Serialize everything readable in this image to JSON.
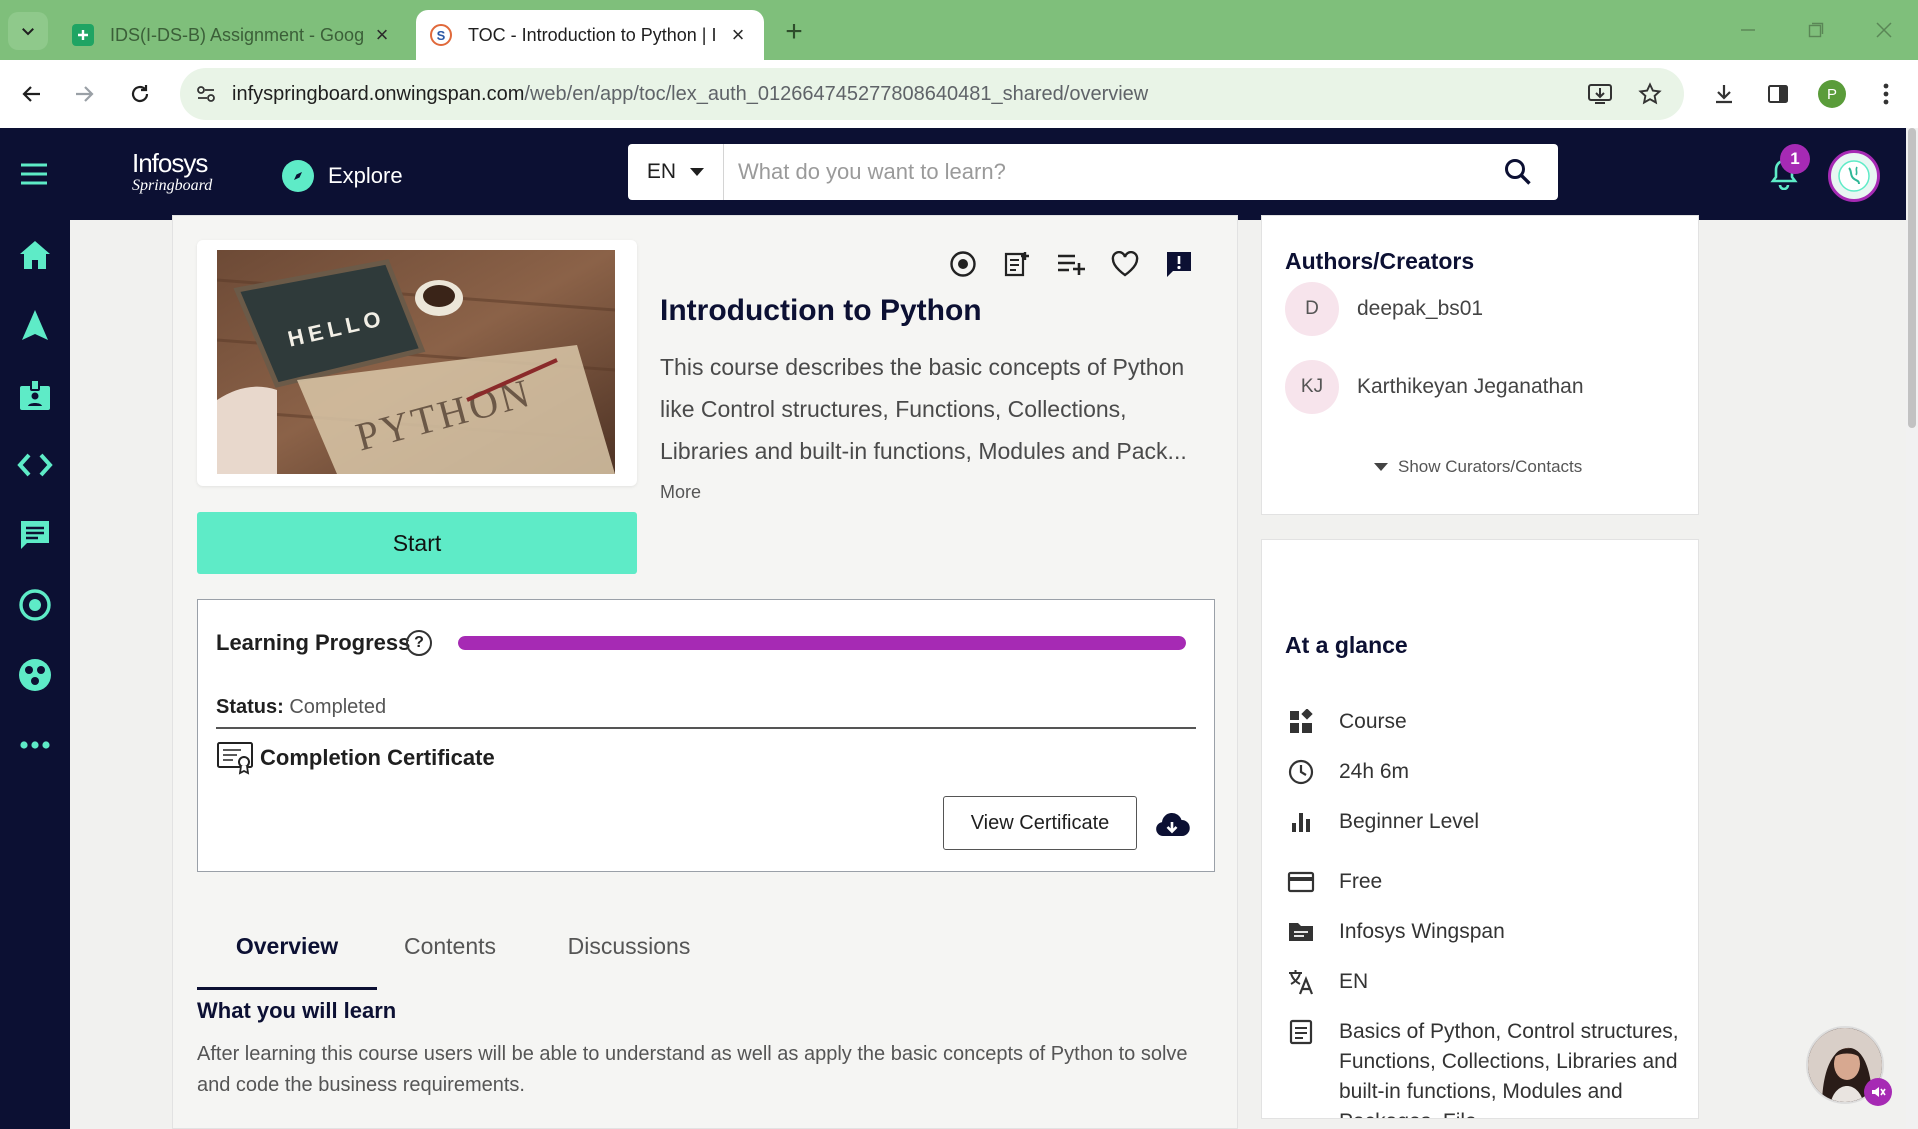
{
  "browser": {
    "tabs": [
      {
        "title": "IDS(I-DS-B) Assignment - Goog",
        "favicon": "google-sheets-icon",
        "active": false
      },
      {
        "title": "TOC - Introduction to Python | I",
        "favicon": "springboard-icon",
        "active": true
      }
    ],
    "url_host": "infyspringboard.onwingspan.com",
    "url_path": "/web/en/app/toc/lex_auth_0126647452778086404​81_shared/overview",
    "profile_initial": "P"
  },
  "header": {
    "logo_line1": "Infosys",
    "logo_line2": "Springboard",
    "explore_label": "Explore",
    "language": "EN",
    "search_placeholder": "What do you want to learn?",
    "notification_count": "1"
  },
  "sidebar": {
    "items": [
      "home-icon",
      "navigate-icon",
      "badge-icon",
      "code-icon",
      "chat-icon",
      "target-icon",
      "community-icon",
      "more-icon"
    ]
  },
  "course": {
    "title": "Introduction to Python",
    "description": "This course describes the basic concepts of Python like Control structures, Functions, Collections, Libraries and built-in functions, Modules and Pack...",
    "more_label": "More",
    "start_label": "Start",
    "thumbnail_text_hello": "HELLO",
    "thumbnail_text_python": "PYTHON"
  },
  "progress": {
    "label": "Learning Progress",
    "help_symbol": "?",
    "percent": 100,
    "color": "#a62ab4",
    "status_key": "Status:",
    "status_value": "Completed",
    "certificate_label": "Completion Certificate",
    "view_certificate_label": "View Certificate"
  },
  "tabs": [
    {
      "label": "Overview",
      "active": true
    },
    {
      "label": "Contents",
      "active": false
    },
    {
      "label": "Discussions",
      "active": false
    }
  ],
  "overview": {
    "heading": "What you will learn",
    "text": "After learning this course users will be able to understand as well as apply the basic concepts of Python to solve and code the business requirements."
  },
  "authors": {
    "title": "Authors/Creators",
    "list": [
      {
        "initials": "D",
        "name": "deepak_bs01"
      },
      {
        "initials": "KJ",
        "name": "Karthikeyan Jeganathan"
      }
    ],
    "show_curators_label": "Show Curators/Contacts"
  },
  "glance": {
    "title": "At a glance",
    "rows": [
      {
        "icon": "course-type-icon",
        "text": "Course"
      },
      {
        "icon": "clock-icon",
        "text": "24h 6m"
      },
      {
        "icon": "level-icon",
        "text": "Beginner Level"
      },
      {
        "icon": "price-icon",
        "text": "Free"
      },
      {
        "icon": "source-icon",
        "text": "Infosys Wingspan"
      },
      {
        "icon": "language-icon",
        "text": "EN"
      },
      {
        "icon": "topics-icon",
        "text": "Basics of Python, Control structures, Functions, Collections, Libraries and built-in functions, Modules and Packages, File"
      }
    ]
  },
  "colors": {
    "brand_dark": "#0c1033",
    "accent": "#5eebc7",
    "progress": "#a62ab4",
    "chrome_green": "#7fbf7b"
  }
}
